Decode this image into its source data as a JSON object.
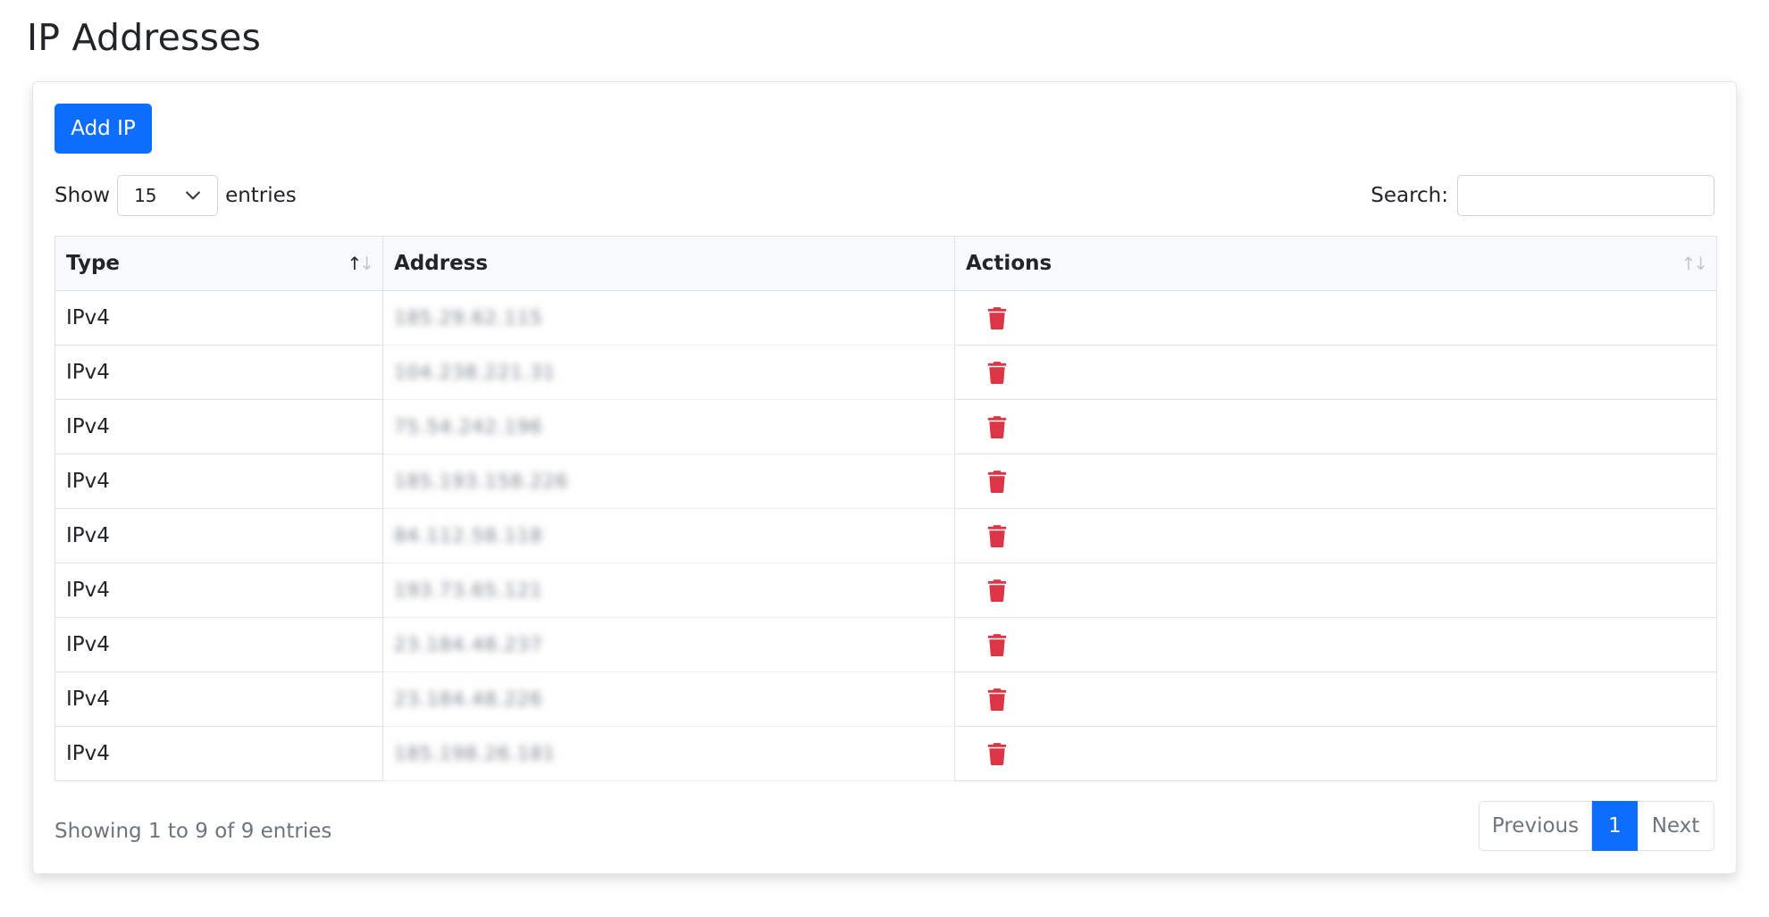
{
  "page": {
    "title": "IP Addresses"
  },
  "toolbar": {
    "add_label": "Add IP"
  },
  "length_menu": {
    "show_label": "Show",
    "selected": "15",
    "entries_label": "entries"
  },
  "search": {
    "label": "Search:",
    "value": ""
  },
  "table": {
    "columns": [
      "Type",
      "Address",
      "Actions"
    ],
    "rows": [
      {
        "type": "IPv4",
        "address": "185.29.62.115"
      },
      {
        "type": "IPv4",
        "address": "104.238.221.31"
      },
      {
        "type": "IPv4",
        "address": "75.54.242.196"
      },
      {
        "type": "IPv4",
        "address": "185.193.158.226"
      },
      {
        "type": "IPv4",
        "address": "84.112.58.118"
      },
      {
        "type": "IPv4",
        "address": "193.73.65.121"
      },
      {
        "type": "IPv4",
        "address": "23.184.48.237"
      },
      {
        "type": "IPv4",
        "address": "23.184.48.226"
      },
      {
        "type": "IPv4",
        "address": "185.198.26.181"
      }
    ],
    "delete_icon": "trash-icon"
  },
  "footer": {
    "info": "Showing 1 to 9 of 9 entries"
  },
  "pagination": {
    "previous": "Previous",
    "current": "1",
    "next": "Next"
  },
  "colors": {
    "primary": "#0d6efd",
    "danger": "#dc3545",
    "header_bg": "#f8f9fa",
    "border": "#dee2e6"
  }
}
